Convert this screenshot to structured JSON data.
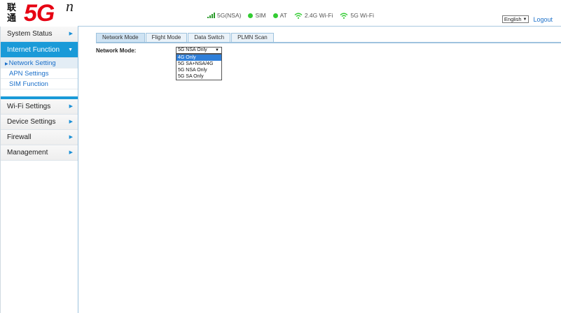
{
  "header": {
    "logo_cn": "联通",
    "logo_5g": "5G",
    "logo_n": "n",
    "status": {
      "network": "5G(NSA)",
      "sim": "SIM",
      "at": "AT",
      "wifi24": "2.4G Wi-Fi",
      "wifi5": "5G Wi-Fi"
    },
    "language": "English",
    "logout": "Logout"
  },
  "colors": {
    "accent": "#1a9ad8",
    "brand_red": "#e60012",
    "status_green": "#33cc33",
    "link_blue": "#1a6fc9"
  },
  "sidebar": {
    "items": [
      {
        "label": "System Status"
      },
      {
        "label": "Internet Function"
      },
      {
        "label": "Wi-Fi Settings"
      },
      {
        "label": "Device Settings"
      },
      {
        "label": "Firewall"
      },
      {
        "label": "Management"
      }
    ],
    "sub_items": [
      {
        "label": "Network Setting"
      },
      {
        "label": "APN Settings"
      },
      {
        "label": "SIM Function"
      }
    ]
  },
  "tabs": [
    {
      "label": "Network Mode"
    },
    {
      "label": "Flight Mode"
    },
    {
      "label": "Data Switch"
    },
    {
      "label": "PLMN Scan"
    }
  ],
  "form": {
    "network_mode_label": "Network Mode:",
    "selected": "5G NSA Only",
    "options": [
      "4G Only",
      "5G SA+NSA/4G",
      "5G NSA Only",
      "5G SA Only"
    ]
  }
}
